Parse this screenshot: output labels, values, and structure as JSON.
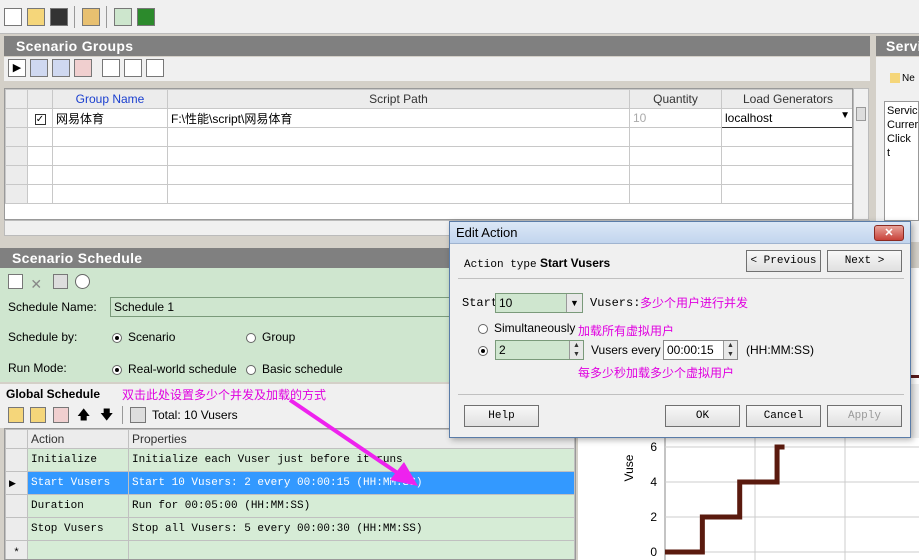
{
  "scenario_groups": {
    "header": "Scenario Groups",
    "columns": [
      "Group Name",
      "Script Path",
      "Quantity",
      "Load Generators"
    ],
    "rows": [
      {
        "group_name": "网易体育",
        "script_path": "F:\\性能\\script\\网易体育",
        "quantity": "10",
        "load_generator": "localhost"
      }
    ]
  },
  "side_panel": {
    "header": "Servi",
    "new_label": "Ne",
    "lines": [
      "Servic",
      "Currer",
      "Click t"
    ]
  },
  "scenario_schedule": {
    "header": "Scenario Schedule",
    "schedule_name_label": "Schedule Name:",
    "schedule_name_value": "Schedule 1",
    "schedule_by_label": "Schedule by:",
    "schedule_by_options": [
      "Scenario",
      "Group"
    ],
    "run_mode_label": "Run Mode:",
    "run_mode_options": [
      "Real-world schedule",
      "Basic schedule"
    ]
  },
  "global_schedule": {
    "title": "Global Schedule",
    "annotation": "双击此处设置多少个并发及加载的方式",
    "total": "Total: 10 Vusers",
    "columns": [
      "Action",
      "Properties"
    ],
    "rows": [
      {
        "action": "Initialize",
        "properties": "Initialize each Vuser just before it runs"
      },
      {
        "action": "Start  Vusers",
        "properties": "Start 10 Vusers: 2 every 00:00:15 (HH:MM:SS)"
      },
      {
        "action": "Duration",
        "properties": "Run for 00:05:00 (HH:MM:SS)"
      },
      {
        "action": "Stop Vusers",
        "properties": "Stop all Vusers: 5 every 00:00:30 (HH:MM:SS)"
      }
    ],
    "new_row_marker": "*"
  },
  "edit_action": {
    "title": "Edit Action",
    "close_glyph": "✕",
    "action_type_label": "Action type",
    "action_type_value": "Start Vusers",
    "previous_label": "< Previous",
    "next_label": "Next >",
    "start_label": "Start",
    "start_value": "10",
    "vusers_label": "Vusers:",
    "note_concurrency": "多少个用户进行并发",
    "simultaneously_label": "Simultaneously",
    "note_all": "加载所有虚拟用户",
    "every_count": "2",
    "vusers_every_label": "Vusers every",
    "every_time": "00:00:15",
    "time_format": "(HH:MM:SS)",
    "note_interval": "每多少秒加载多少个虚拟用户",
    "help_label": "Help",
    "ok_label": "OK",
    "cancel_label": "Cancel",
    "apply_label": "Apply"
  },
  "chart_data": {
    "type": "line",
    "ylabel": "Vuse",
    "yticks": [
      "0",
      "2",
      "4",
      "6"
    ],
    "ylim": [
      0,
      8
    ],
    "series": [
      {
        "x": [
          0,
          0.25,
          0.25,
          0.5,
          0.5,
          0.75,
          0.75
        ],
        "y": [
          0,
          0,
          2,
          2,
          4,
          4,
          6
        ]
      }
    ]
  }
}
